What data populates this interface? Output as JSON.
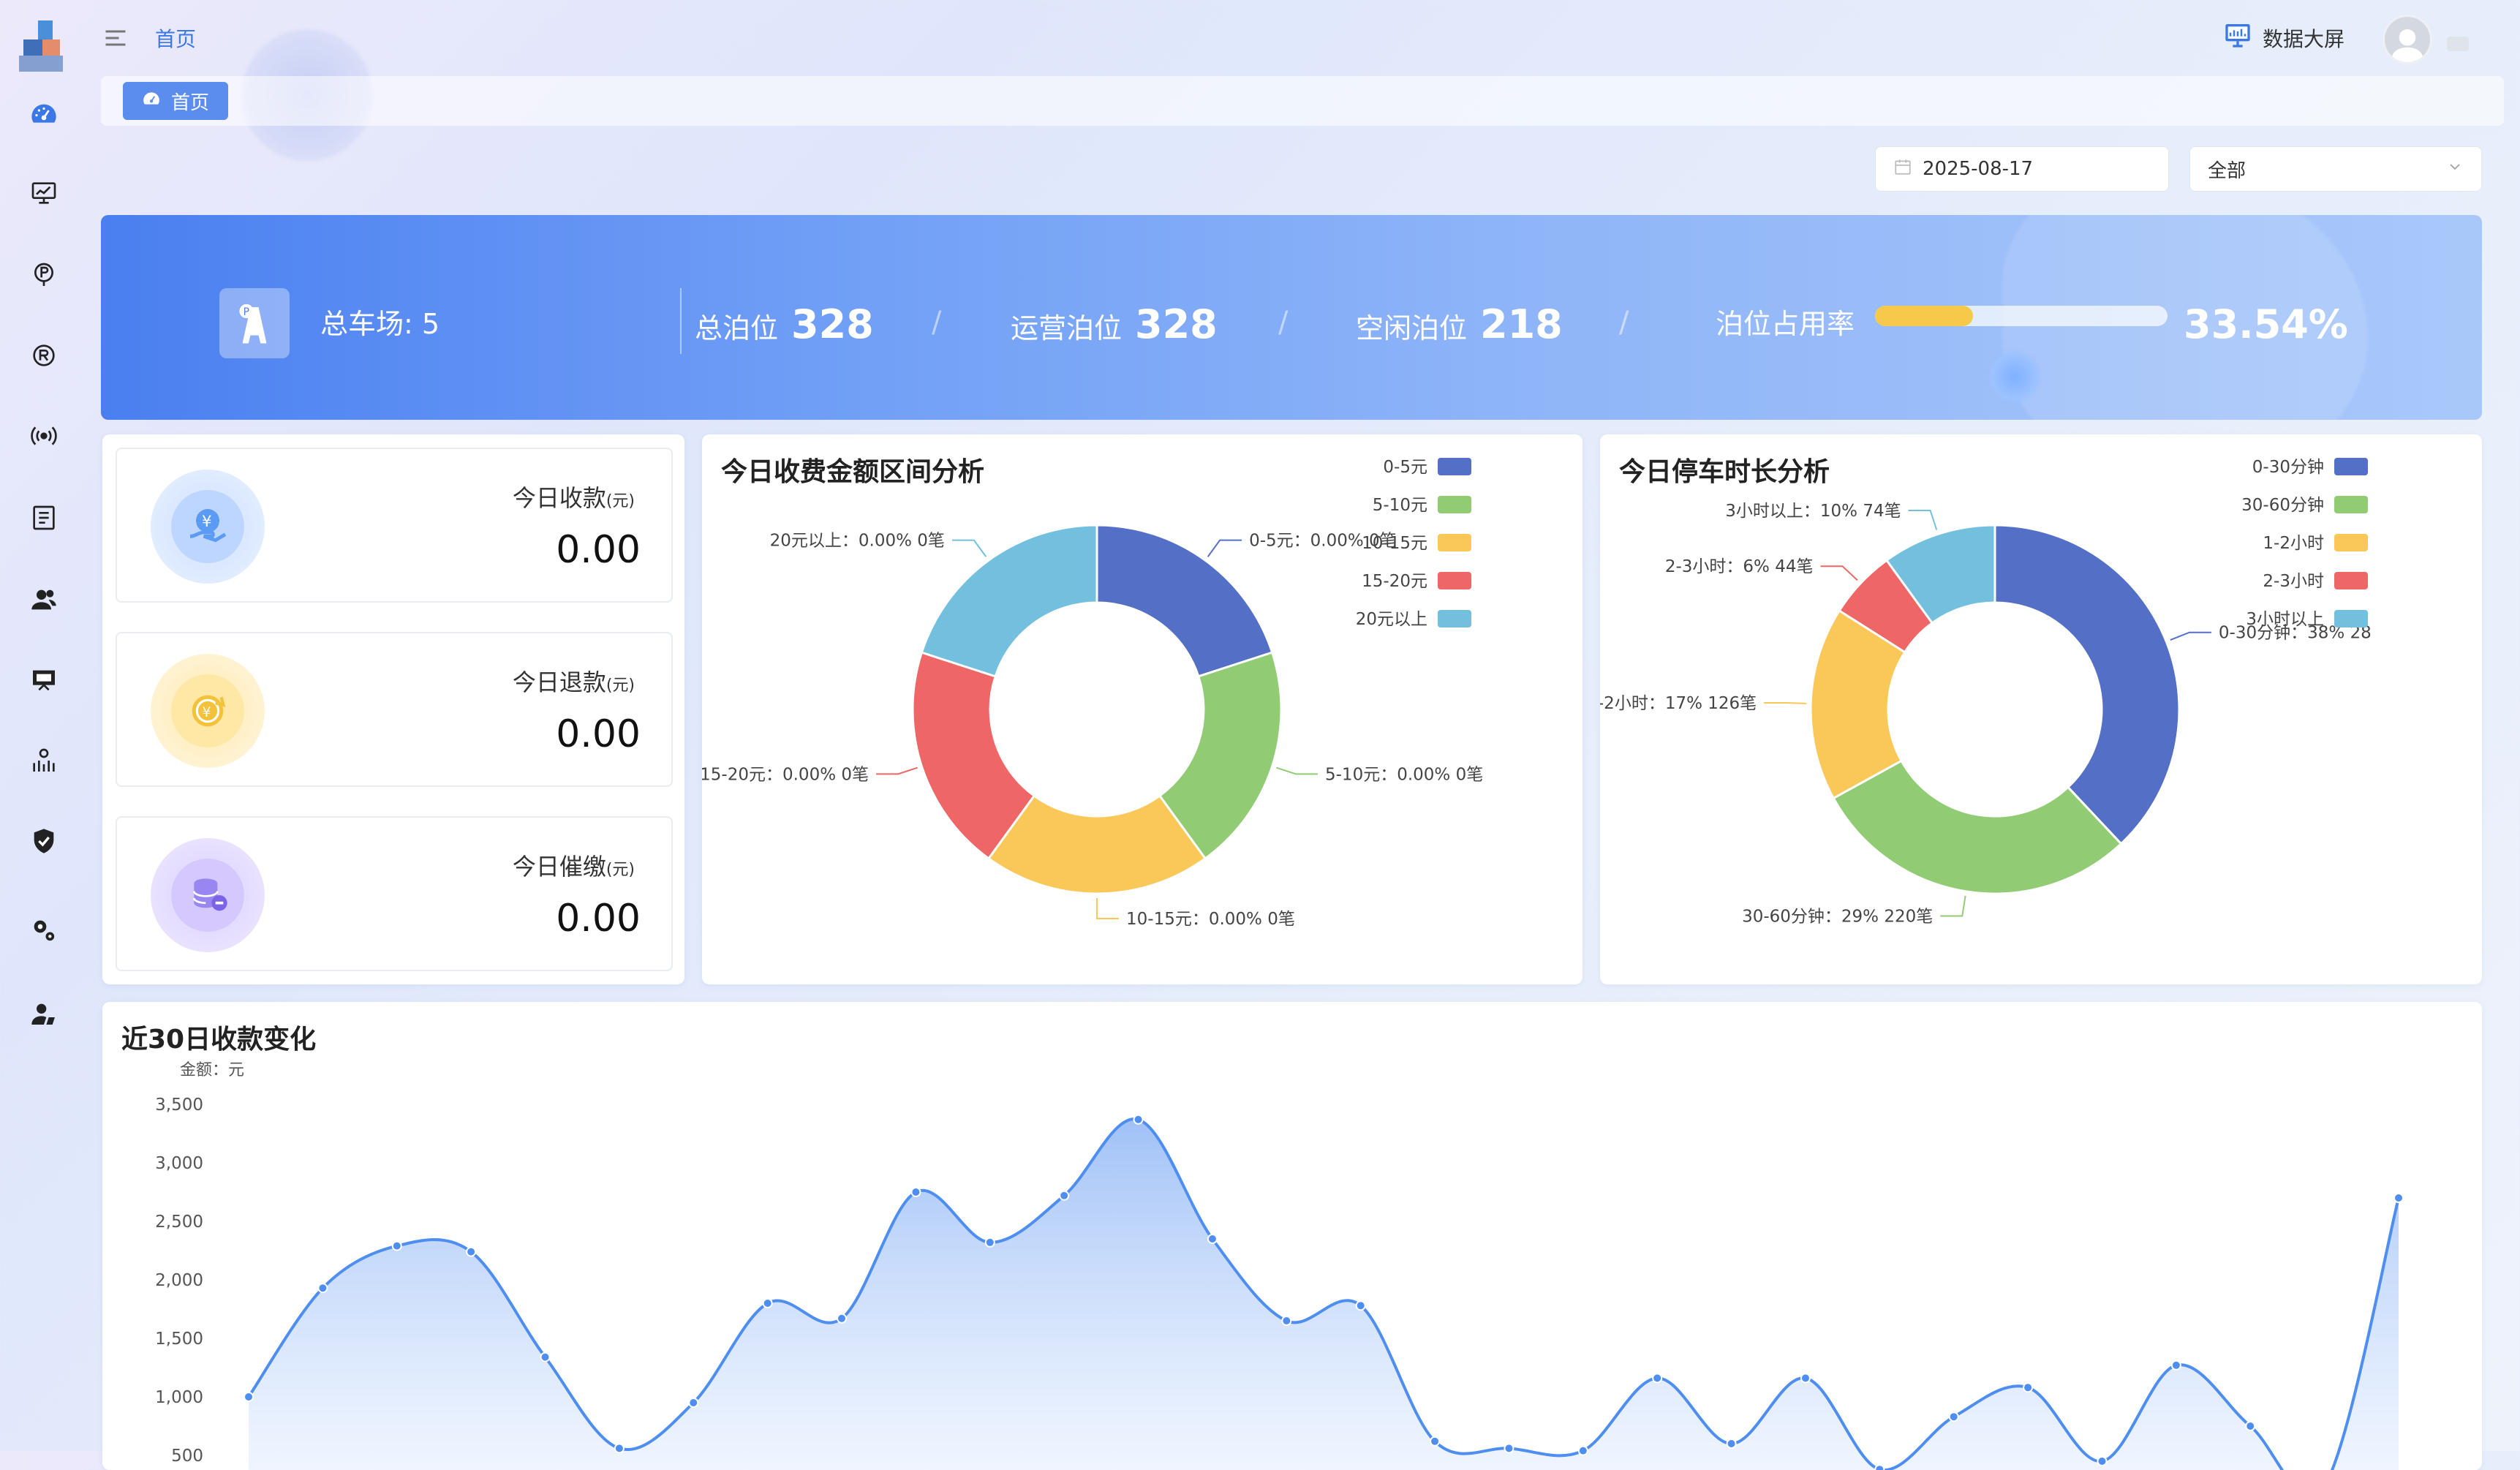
{
  "topbar": {
    "breadcrumb_home": "首页",
    "big_screen_label": "数据大屏"
  },
  "tabs": [
    {
      "label": "首页"
    }
  ],
  "filters": {
    "date_value": "2025-08-17",
    "area_value": "全部"
  },
  "banner": {
    "lots_label": "总车场: 5",
    "total_label": "总泊位",
    "total_value": "328",
    "operating_label": "运营泊位",
    "operating_value": "328",
    "idle_label": "空闲泊位",
    "idle_value": "218",
    "occupancy_label": "泊位占用率",
    "occupancy_value": "33.54%",
    "occupancy_fraction": 0.3354
  },
  "stats": [
    {
      "label": "今日收款",
      "unit": "(元)",
      "value": "0.00"
    },
    {
      "label": "今日退款",
      "unit": "(元)",
      "value": "0.00"
    },
    {
      "label": "今日催缴",
      "unit": "(元)",
      "value": "0.00"
    }
  ],
  "colors": {
    "accent": "#3a78e8",
    "series": [
      "#5470c6",
      "#91cc75",
      "#fac858",
      "#ee6666",
      "#73c0de"
    ]
  },
  "chart_data": [
    {
      "type": "pie",
      "title": "今日收费金额区间分析",
      "legend_position": "top-right",
      "slices": [
        {
          "name": "0-5元",
          "percent": "0.00%",
          "count": "0笔",
          "value": 1
        },
        {
          "name": "5-10元",
          "percent": "0.00%",
          "count": "0笔",
          "value": 1
        },
        {
          "name": "10-15元",
          "percent": "0.00%",
          "count": "0笔",
          "value": 1
        },
        {
          "name": "15-20元",
          "percent": "0.00%",
          "count": "0笔",
          "value": 1
        },
        {
          "name": "20元以上",
          "percent": "0.00%",
          "count": "0笔",
          "value": 1
        }
      ]
    },
    {
      "type": "pie",
      "title": "今日停车时长分析",
      "legend_position": "top-right",
      "slices": [
        {
          "name": "0-30分钟",
          "percent": "38%",
          "count": "28",
          "value": 38
        },
        {
          "name": "30-60分钟",
          "percent": "29%",
          "count": "220笔",
          "value": 29
        },
        {
          "name": "1-2小时",
          "percent": "17%",
          "count": "126笔",
          "value": 17
        },
        {
          "name": "2-3小时",
          "percent": "6%",
          "count": "44笔",
          "value": 6
        },
        {
          "name": "3小时以上",
          "percent": "10%",
          "count": "74笔",
          "value": 10
        }
      ]
    },
    {
      "type": "area",
      "title": "近30日收款变化",
      "ylabel": "金额：元",
      "ylim": [
        500,
        3500
      ],
      "yticks": [
        "3,500",
        "3,000",
        "2,500",
        "2,000",
        "1,500",
        "1,000",
        "500"
      ],
      "grid": false,
      "values": [
        1000,
        1930,
        2290,
        2240,
        1340,
        560,
        950,
        1800,
        1670,
        2750,
        2320,
        2720,
        3370,
        2350,
        1650,
        1780,
        620,
        560,
        540,
        1160,
        600,
        1160,
        380,
        830,
        1080,
        450,
        1270,
        750,
        240,
        2700
      ]
    }
  ]
}
